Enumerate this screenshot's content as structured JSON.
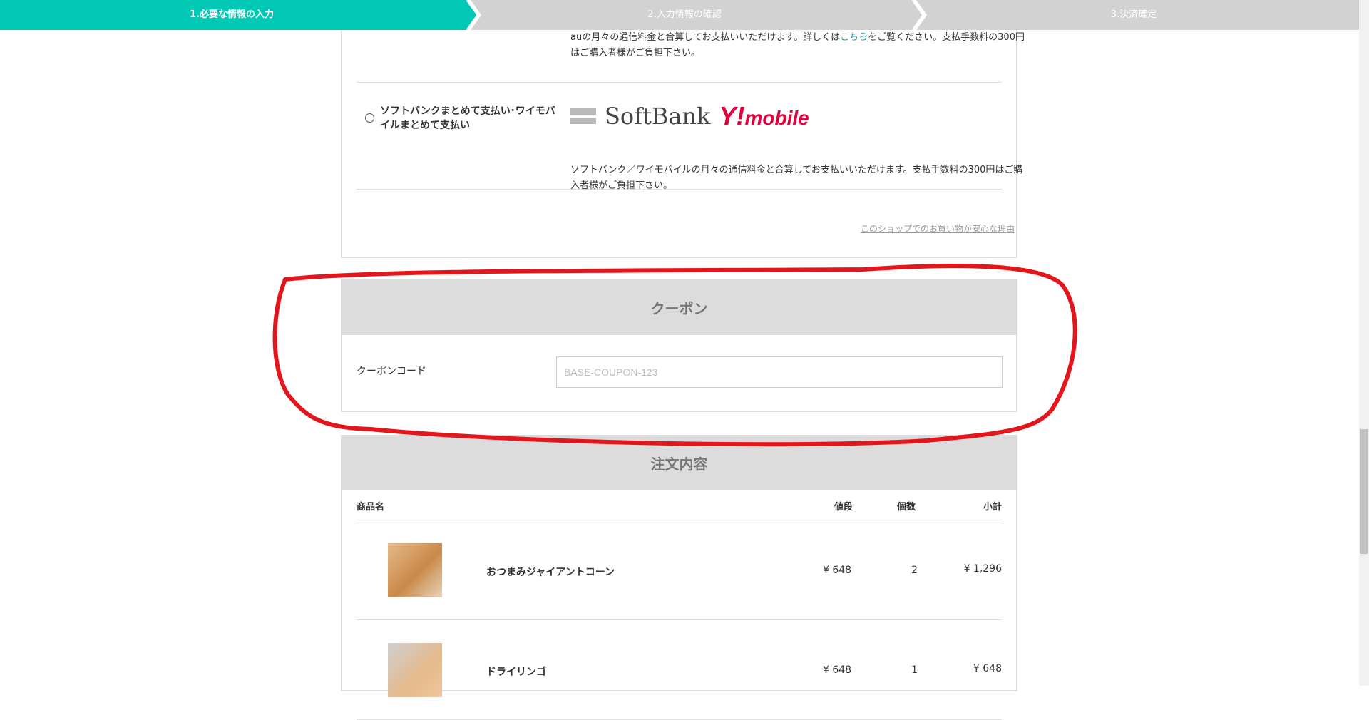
{
  "steps": [
    {
      "label": "1.必要な情報の入力",
      "active": true
    },
    {
      "label": "2.入力情報の確認",
      "active": false
    },
    {
      "label": "3.決済確定",
      "active": false
    }
  ],
  "colors": {
    "accent": "#00c8b4",
    "step_inactive": "#d2d2d2",
    "annotation": "#e3161b",
    "link": "#1f9ca9"
  },
  "payment": {
    "au_desc_part1": "auの月々の通信料金と合算してお支払いいただけます。詳しくは",
    "au_link": "こちら",
    "au_desc_part2": "をご覧ください。支払手数料の300円はご購入者様がご負担下さい。",
    "softbank_label": "ソフトバンクまとめて支払い･ワイモバイルまとめて支払い",
    "softbank_logo_text": "SoftBank",
    "ymobile_logo_y": "Y!",
    "ymobile_logo_text": "mobile",
    "softbank_desc": "ソフトバンク／ワイモバイルの月々の通信料金と合算してお支払いいただけます。支払手数料の300円はご購入者様がご負担下さい。",
    "safety_link": "このショップでのお買い物が安心な理由"
  },
  "coupon": {
    "title": "クーポン",
    "code_label": "クーポンコード",
    "placeholder": "BASE-COUPON-123",
    "value": ""
  },
  "order": {
    "title": "注文内容",
    "headers": {
      "name": "商品名",
      "price": "値段",
      "qty": "個数",
      "subtotal": "小計"
    },
    "items": [
      {
        "name": "おつまみジャイアントコーン",
        "price": "¥ 648",
        "qty": "2",
        "subtotal": "¥ 1,296"
      },
      {
        "name": "ドライリンゴ",
        "price": "¥ 648",
        "qty": "1",
        "subtotal": "¥ 648"
      }
    ]
  }
}
